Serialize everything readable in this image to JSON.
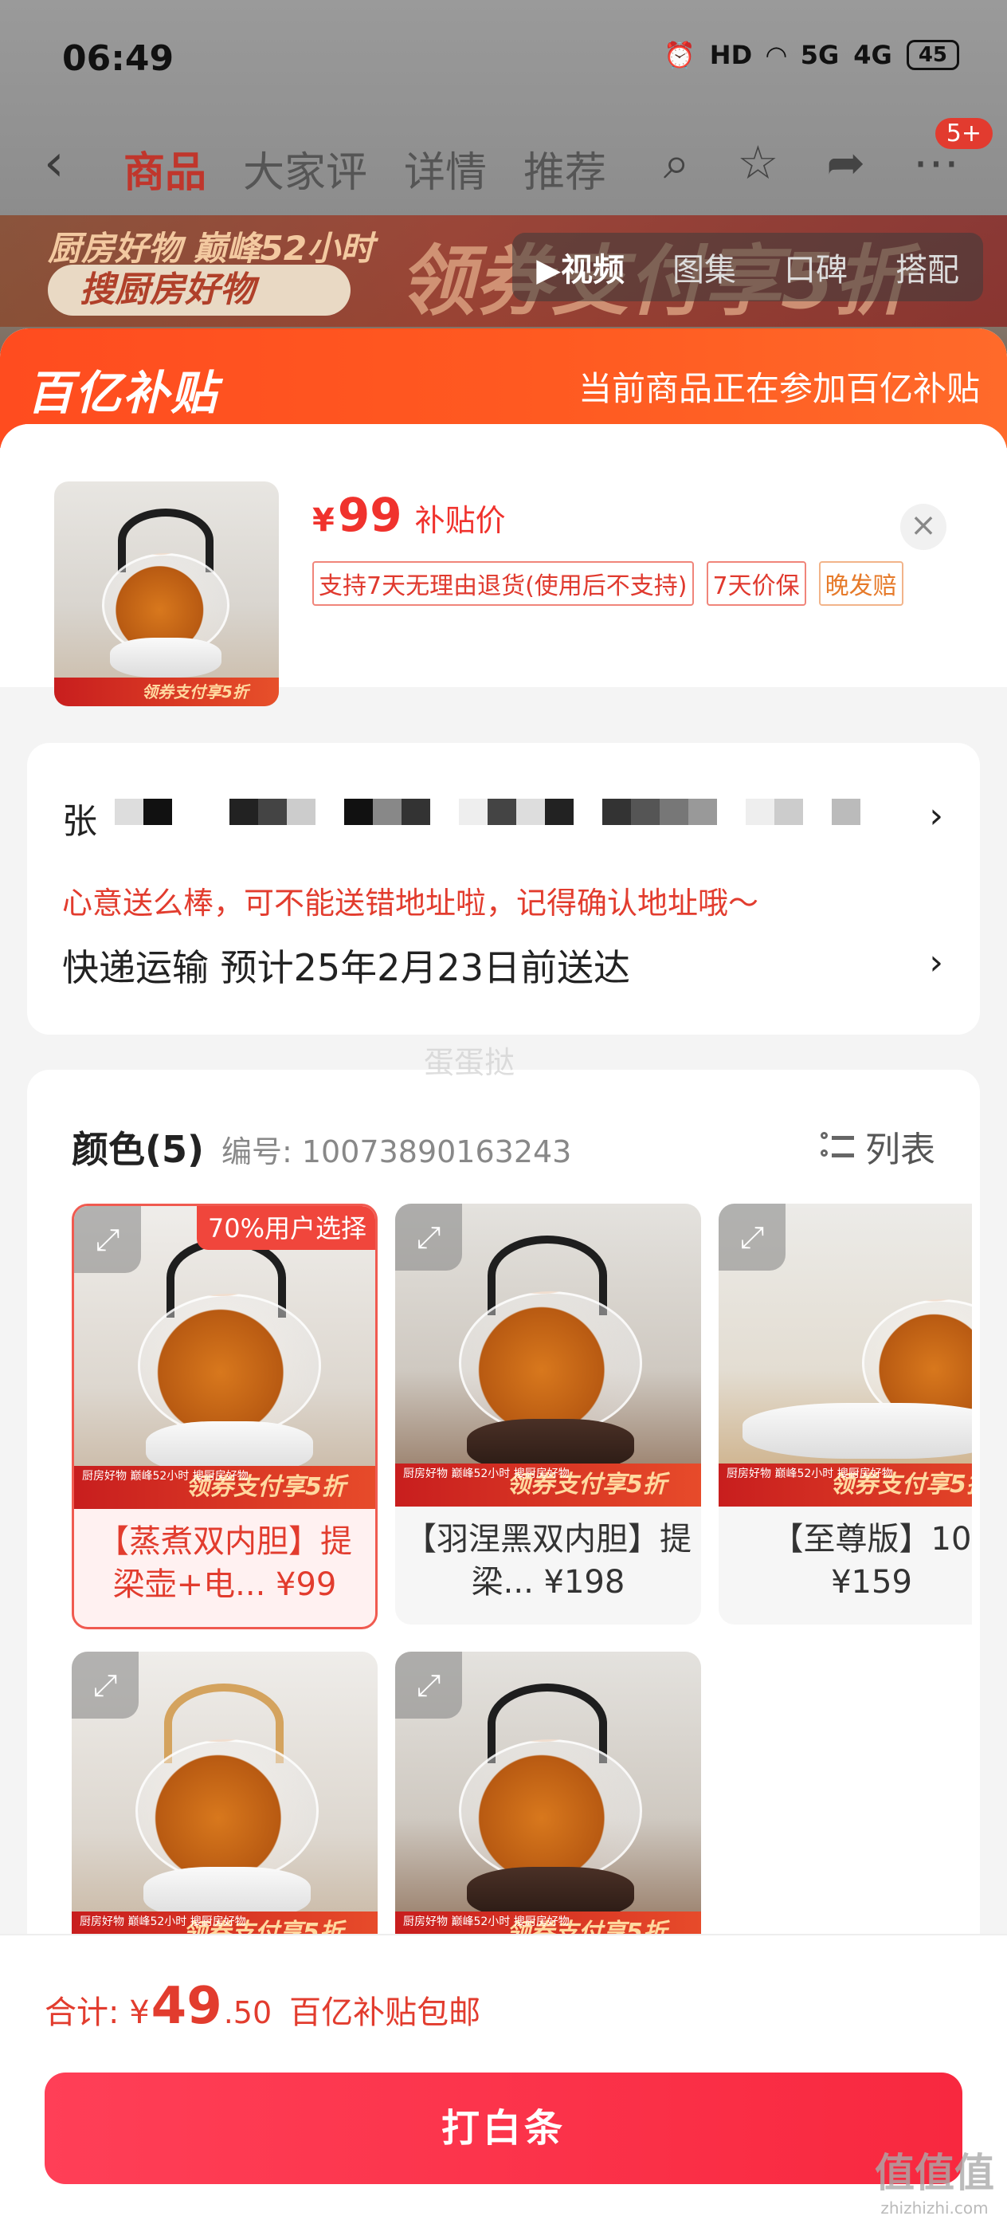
{
  "status_bar": {
    "time": "06:49",
    "hd_label": "HD",
    "signal_5g": "5G",
    "signal_4g": "4G",
    "battery": "45"
  },
  "nav": {
    "back_icon": "chevron-left-icon",
    "tabs": [
      {
        "label": "商品",
        "active": true
      },
      {
        "label": "大家评",
        "active": false
      },
      {
        "label": "详情",
        "active": false
      },
      {
        "label": "推荐",
        "active": false
      }
    ],
    "badge": "5+"
  },
  "background_banner": {
    "line1": "厨房好物 巅峰52小时",
    "search_pill": "搜厨房好物",
    "big_text": "领券支付享5折"
  },
  "media_tabs": [
    "▶视频",
    "图集",
    "口碑",
    "搭配"
  ],
  "subsidy": {
    "logo": "百亿补贴",
    "tip": "当前商品正在参加百亿补贴"
  },
  "product": {
    "currency": "¥",
    "price": "99",
    "price_label": "补贴价",
    "tags": [
      "支持7天无理由退货(使用后不支持)",
      "7天价保",
      "晚发赔"
    ],
    "thumb_promo": "领券支付享5折"
  },
  "address": {
    "name_initial": "张",
    "warning": "心意送么棒，可不能送错地址啦，记得确认地址哦～",
    "shipping": "快递运输 预计25年2月23日前送达"
  },
  "colors": {
    "title": "颜色(5)",
    "code": "编号: 10073890163243",
    "list_label": "列表",
    "popular_badge": "70%用户选择",
    "promo_small": "厨房好物 巅峰52小时 搜厨房好物",
    "promo_text": "领券支付享5折",
    "variants": [
      {
        "label": "【蒸煮双内胆】提梁壶+电...",
        "price": "¥99"
      },
      {
        "label": "【羽涅黑双内胆】提梁...",
        "price": "¥198"
      },
      {
        "label": "【至尊版】10",
        "price": "¥159"
      },
      {
        "label": "",
        "price": ""
      },
      {
        "label": "",
        "price": ""
      }
    ]
  },
  "watermark_mid": "蛋蛋挞",
  "total": {
    "label": "合计:",
    "currency": "¥",
    "integer": "49",
    "decimal": ".50",
    "note": "百亿补贴包邮"
  },
  "pay_button": "打白条",
  "corner_watermark": {
    "main": "值值值",
    "sub": "zhizhizhi.com"
  },
  "colors_theme": {
    "accent": "#F0322D",
    "subsidy_orange": "#FF5A21",
    "pay_button": "#F8283F"
  }
}
